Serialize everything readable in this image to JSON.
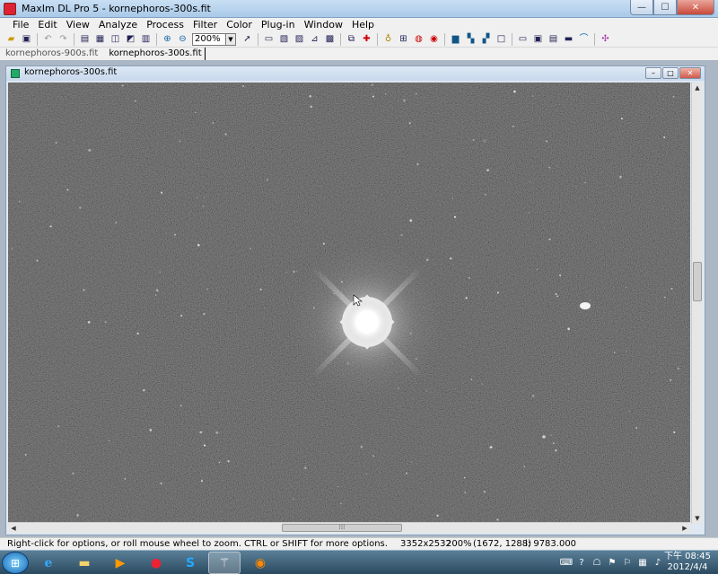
{
  "window": {
    "title": "MaxIm DL Pro 5 - kornephoros-300s.fit",
    "min": "—",
    "max": "☐",
    "close": "✕"
  },
  "menu": [
    "File",
    "Edit",
    "View",
    "Analyze",
    "Process",
    "Filter",
    "Color",
    "Plug-in",
    "Window",
    "Help"
  ],
  "toolbar": {
    "zoom": "200%"
  },
  "doc_tabs": [
    "kornephoros-900s.fit",
    "kornephoros-300s.fit"
  ],
  "child": {
    "title": "kornephoros-300s.fit",
    "min": "–",
    "max": "□",
    "close": "✕"
  },
  "status": {
    "hint": "Right-click for options, or roll mouse wheel to zoom. CTRL or SHIFT for more options.",
    "dims": "3352x2532",
    "zoom": "200%",
    "coords": "(1672, 1288)",
    "intensity": "i: 9783.000"
  },
  "taskbar": {
    "time": "下午 08:45",
    "date": "2012/4/4"
  }
}
